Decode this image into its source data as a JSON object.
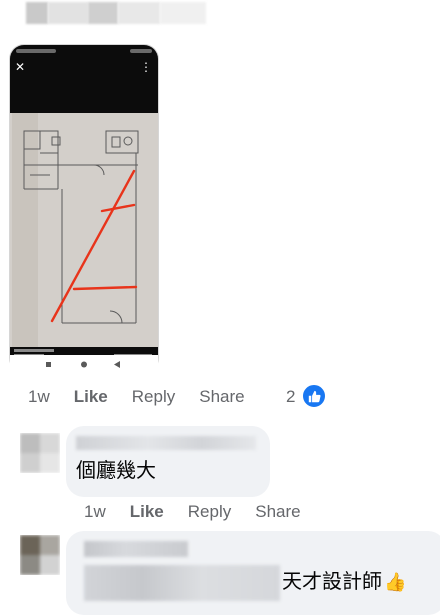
{
  "post": {
    "actions": {
      "time": "1w",
      "like": "Like",
      "reply": "Reply",
      "share": "Share"
    },
    "reaction_count": "2",
    "reaction_icon": "thumbs-up-icon"
  },
  "comments": [
    {
      "text": "個廳幾大",
      "actions": {
        "time": "1w",
        "like": "Like",
        "reply": "Reply",
        "share": "Share"
      }
    },
    {
      "text": "天才設計師",
      "emoji": "👍"
    }
  ],
  "colors": {
    "accent": "#1877f2",
    "bubble": "#f0f2f5",
    "muted": "#65676b",
    "plan_line": "#e8341b"
  }
}
